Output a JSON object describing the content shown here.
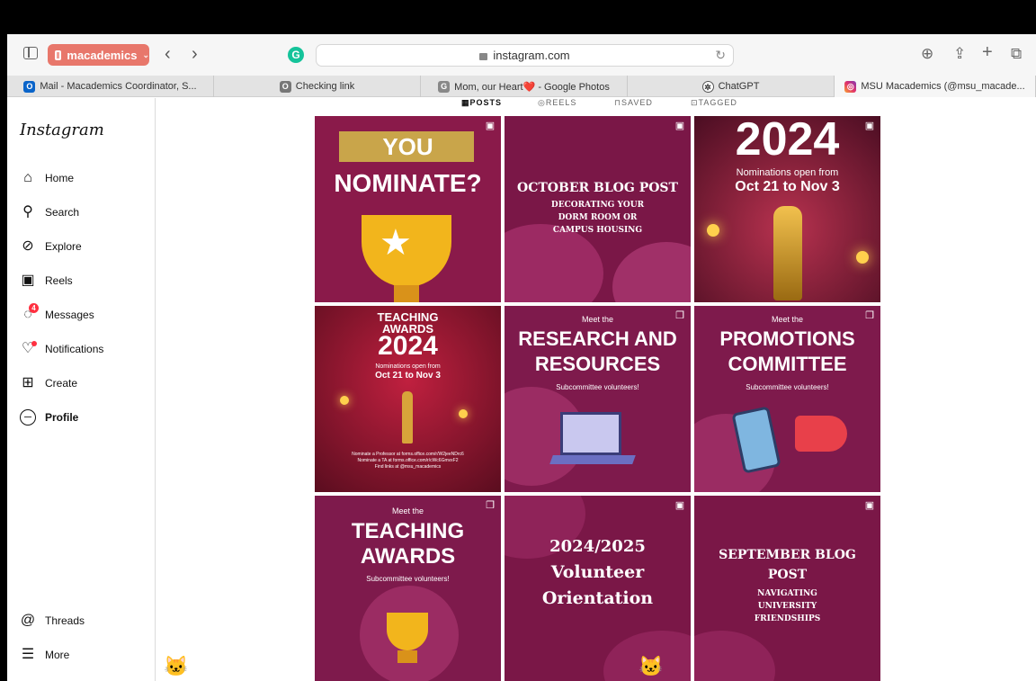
{
  "browser": {
    "tab_group": "macademics",
    "url": "instagram.com",
    "tabs": [
      {
        "label": "Mail - Macademics Coordinator, S...",
        "icon": "outlook-icon"
      },
      {
        "label": "Checking link",
        "icon": "page-icon"
      },
      {
        "label": "Mom, our Heart❤️ - Google Photos",
        "icon": "google-photos-icon"
      },
      {
        "label": "ChatGPT",
        "icon": "chatgpt-icon"
      },
      {
        "label": "MSU Macademics (@msu_macade...",
        "icon": "instagram-icon"
      }
    ]
  },
  "instagram": {
    "logo": "Instagram",
    "nav": [
      {
        "label": "Home",
        "icon": "home-icon"
      },
      {
        "label": "Search",
        "icon": "search-icon"
      },
      {
        "label": "Explore",
        "icon": "explore-icon"
      },
      {
        "label": "Reels",
        "icon": "reels-icon"
      },
      {
        "label": "Messages",
        "icon": "messages-icon",
        "badge": "4"
      },
      {
        "label": "Notifications",
        "icon": "heart-icon"
      },
      {
        "label": "Create",
        "icon": "plus-icon"
      },
      {
        "label": "Profile",
        "icon": "avatar-icon"
      }
    ],
    "bottom_nav": [
      {
        "label": "Threads",
        "icon": "threads-icon"
      },
      {
        "label": "More",
        "icon": "menu-icon"
      }
    ],
    "profile_tabs": [
      "POSTS",
      "REELS",
      "SAVED",
      "TAGGED"
    ],
    "posts": [
      {
        "line1": "YOU",
        "line2": "NOMINATE?"
      },
      {
        "title": "OCTOBER BLOG POST",
        "subtitle": "DECORATING YOUR DORM ROOM OR CAMPUS HOUSING"
      },
      {
        "title": "2024",
        "subtitle": "Nominations open from",
        "dates": "Oct 21 to Nov 3"
      },
      {
        "line1": "TEACHING",
        "line2": "AWARDS",
        "year": "2024",
        "subtitle": "Nominations open from",
        "dates": "Oct 21 to Nov 3",
        "footer1": "Nominate a Professor at forms.office.com/r/W2jeeNDrc6",
        "footer2": "Nominate a TA at forms.office.com/r/cWc6GmvxF2",
        "footer3": "Find links at @msu_macademics"
      },
      {
        "pre": "Meet the",
        "line1": "RESEARCH AND",
        "line2": "RESOURCES",
        "sub": "Subcommittee volunteers!"
      },
      {
        "pre": "Meet the",
        "line1": "PROMOTIONS",
        "line2": "COMMITTEE",
        "sub": "Subcommittee volunteers!"
      },
      {
        "pre": "Meet the",
        "line1": "TEACHING",
        "line2": "AWARDS",
        "sub": "Subcommittee volunteers!"
      },
      {
        "line1": "2024/2025",
        "line2": "Volunteer",
        "line3": "Orientation"
      },
      {
        "title": "SEPTEMBER BLOG",
        "title2": "POST",
        "subtitle": "NAVIGATING UNIVERSITY FRIENDSHIPS"
      }
    ]
  },
  "colors": {
    "maroon": "#7a1747",
    "deep": "#5e0f34",
    "tab_group": "#e8776b",
    "gold": "#f5c518"
  }
}
